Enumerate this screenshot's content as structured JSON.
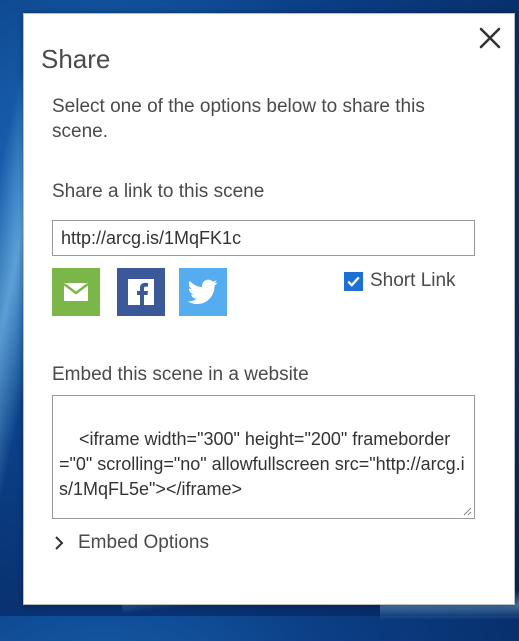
{
  "dialog": {
    "title": "Share",
    "close_icon": "close-icon",
    "description": "Select one of the options below to share this scene.",
    "link": {
      "label": "Share a link to this scene",
      "value": "http://arcg.is/1MqFK1c"
    },
    "share_buttons": [
      {
        "icon": "email-icon",
        "color": "#7ab648"
      },
      {
        "icon": "facebook-icon",
        "color": "#3b5998"
      },
      {
        "icon": "twitter-icon",
        "color": "#55acee"
      }
    ],
    "short_link": {
      "label": "Short Link",
      "checked": true,
      "color": "#1d6fd1"
    },
    "embed": {
      "label": "Embed this scene in a website",
      "code": "<iframe width=\"300\" height=\"200\" frameborder=\"0\" scrolling=\"no\" allowfullscreen src=\"http://arcg.is/1MqFL5e\"></iframe>"
    },
    "embed_options": {
      "label": "Embed Options",
      "icon": "chevron-right-icon"
    }
  }
}
